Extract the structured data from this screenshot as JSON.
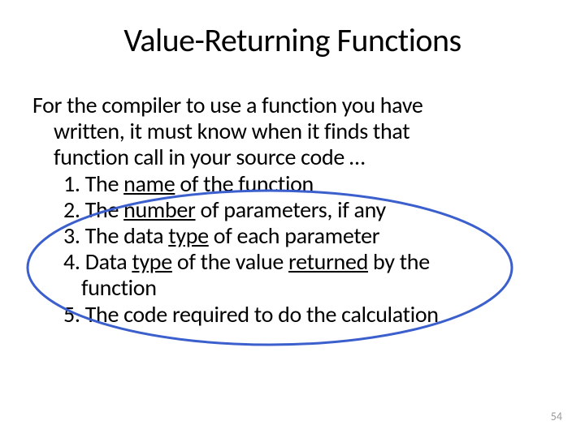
{
  "title": "Value-Returning Functions",
  "intro_l1": "For the compiler to use a function you have",
  "intro_l2": "written, it must know when it finds that",
  "intro_l3": "function call in your source code …",
  "item1_pre": "1. The ",
  "item1_u": "name",
  "item1_post": " of the function",
  "item2_pre": "2. The ",
  "item2_u": "number",
  "item2_post": " of parameters, if any",
  "item3_pre": "3. The data ",
  "item3_u": "type",
  "item3_post": " of each parameter",
  "item4_pre": "4. Data ",
  "item4_u1": "type",
  "item4_mid": " of the value ",
  "item4_u2": "returned",
  "item4_post": " by the",
  "item4_cont": "function",
  "item5": "5. The code required to do the calculation",
  "page_number": "54"
}
